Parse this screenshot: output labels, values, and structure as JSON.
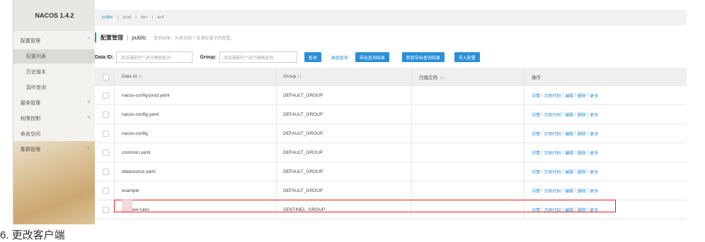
{
  "sidebar": {
    "title": "NACOS 1.4.2",
    "items": [
      {
        "label": "配置管理",
        "chevron": "^"
      },
      {
        "label": "配置列表"
      },
      {
        "label": "历史版本"
      },
      {
        "label": "监听查询"
      },
      {
        "label": "服务管理",
        "chevron": "v"
      },
      {
        "label": "权限控制",
        "chevron": "v"
      },
      {
        "label": "命名空间"
      },
      {
        "label": "集群管理",
        "chevron": "v"
      }
    ]
  },
  "namespace_bar": {
    "items": [
      "public",
      "|",
      "prod",
      "|",
      "dev",
      "|",
      "test"
    ]
  },
  "page_title": {
    "label": "配置管理",
    "separator": "|",
    "namespace": "public",
    "hint": "查询结果：共查询到 7 条满足要求的配置。"
  },
  "filter": {
    "data_id_label": "Data ID:",
    "data_id_placeholder": "添加通配符'*'进行模糊查询",
    "group_label": "Group:",
    "group_placeholder": "添加通配符'*'进行模糊查询",
    "query_button": "查询",
    "advanced_query": "高级查询",
    "export_query": "导出查询结果",
    "new_export": "新版导出查询结果",
    "import_config": "导入配置"
  },
  "table": {
    "headers": {
      "data_id": "Data Id  ↓↑",
      "group": "Group  ↓↑",
      "app": "归属应用:  ↓↑",
      "ops": "操作"
    },
    "rows": [
      {
        "data_id": "nacos-config-prod.yaml",
        "group": "DEFAULT_GROUP"
      },
      {
        "data_id": "nacos-config.yaml",
        "group": "DEFAULT_GROUP"
      },
      {
        "data_id": "nacos-config",
        "group": "DEFAULT_GROUP"
      },
      {
        "data_id": "common.yaml",
        "group": "DEFAULT_GROUP"
      },
      {
        "data_id": "datasource.yaml",
        "group": "DEFAULT_GROUP"
      },
      {
        "data_id": "example",
        "group": "DEFAULT_GROUP"
      },
      {
        "data_id": "der-flow-rules",
        "group": "SENTINEL_GROUP"
      }
    ],
    "ops": [
      "详情",
      "示例代码",
      "编辑",
      "删除",
      "更多"
    ]
  },
  "footer": {
    "text": "6. 更改客户端"
  },
  "colors": {
    "accent": "#2a8fd8",
    "highlight": "#e02020"
  }
}
